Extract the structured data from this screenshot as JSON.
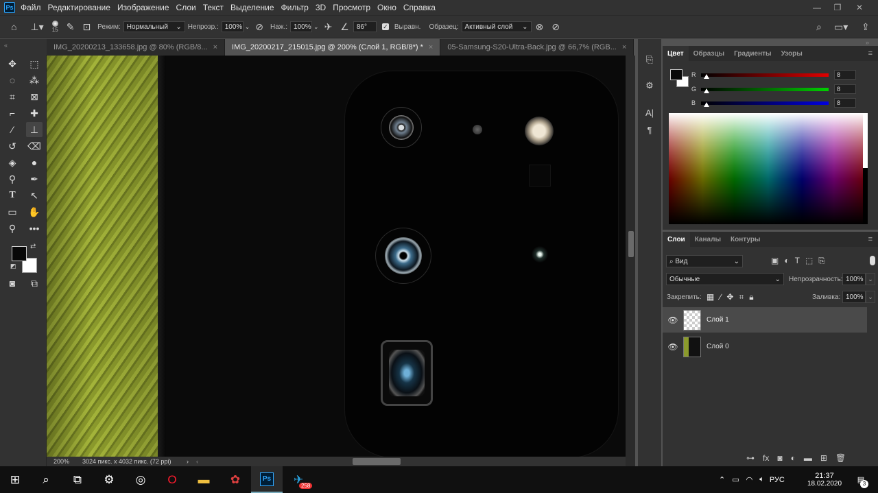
{
  "menu": {
    "logo": "Ps",
    "items": [
      "Файл",
      "Редактирование",
      "Изображение",
      "Слои",
      "Текст",
      "Выделение",
      "Фильтр",
      "3D",
      "Просмотр",
      "Окно",
      "Справка"
    ]
  },
  "window_controls": {
    "minimize": "—",
    "restore": "❐",
    "close": "✕"
  },
  "options_bar": {
    "brush_size": "15",
    "mode_label": "Режим:",
    "mode_value": "Нормальный",
    "opacity_label": "Непрозр.:",
    "opacity_value": "100%",
    "flow_label": "Наж.:",
    "flow_value": "100%",
    "angle_value": "86°",
    "aligned_label": "Выравн.",
    "sample_label": "Образец:",
    "sample_value": "Активный слой"
  },
  "tabs": [
    {
      "label": "IMG_20200213_133658.jpg @ 80% (RGB/8...",
      "close": "×"
    },
    {
      "label": "IMG_20200217_215015.jpg @ 200% (Слой 1, RGB/8*) *",
      "close": "×"
    },
    {
      "label": "05-Samsung-S20-Ultra-Back.jpg @ 66,7% (RGB...",
      "close": "×"
    }
  ],
  "status": {
    "zoom": "200%",
    "doc_info": "3024 пикс. x 4032 пикс. (72 ppi)",
    "arrow": "›"
  },
  "color_panel": {
    "tabs": [
      "Цвет",
      "Образцы",
      "Градиенты",
      "Узоры"
    ],
    "sliders": [
      {
        "label": "R",
        "value": "8",
        "color": "#e00000"
      },
      {
        "label": "G",
        "value": "8",
        "color": "#00d000"
      },
      {
        "label": "B",
        "value": "8",
        "color": "#0000e0"
      }
    ]
  },
  "layers_panel": {
    "tabs": [
      "Слои",
      "Каналы",
      "Контуры"
    ],
    "filter_value": "Вид",
    "blend_value": "Обычные",
    "opacity_label": "Непрозрачность:",
    "opacity_value": "100%",
    "lock_label": "Закрепить:",
    "fill_label": "Заливка:",
    "fill_value": "100%",
    "layers": [
      {
        "name": "Слой 1",
        "selected": true
      },
      {
        "name": "Слой 0",
        "selected": false
      }
    ]
  },
  "taskbar": {
    "telegram_badge": "258",
    "lang": "РУС",
    "time": "21:37",
    "date": "18.02.2020",
    "notif_count": "3"
  }
}
